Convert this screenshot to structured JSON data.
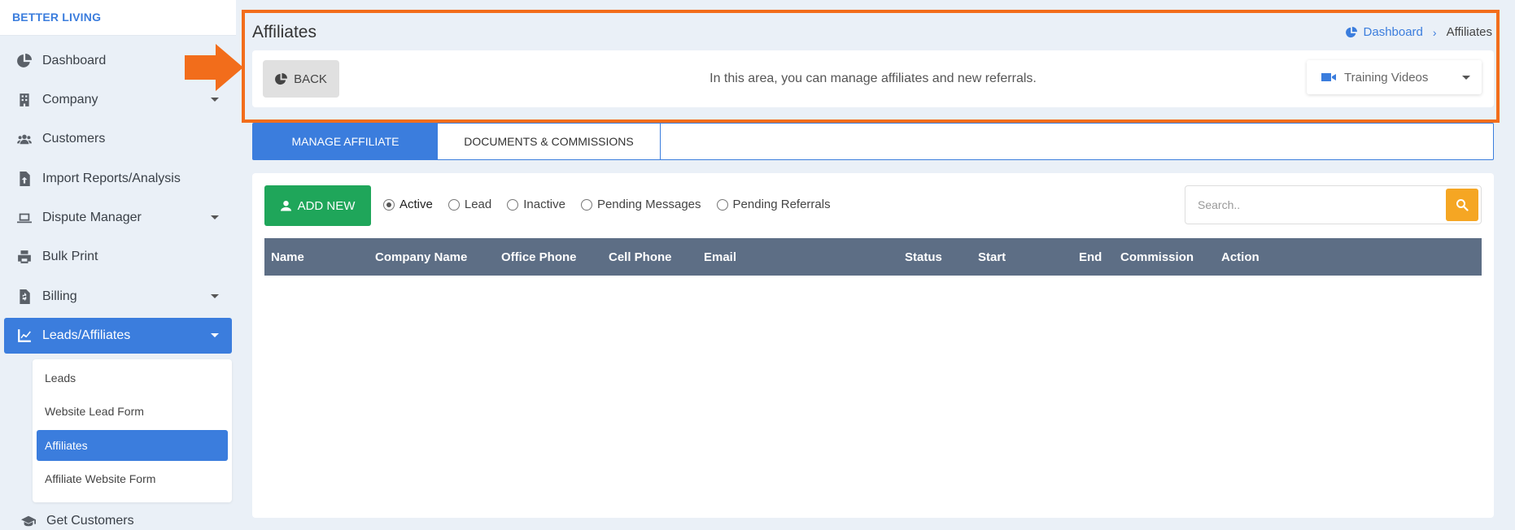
{
  "brand": "BETTER LIVING",
  "sidebar": {
    "items": [
      {
        "label": "Dashboard"
      },
      {
        "label": "Company"
      },
      {
        "label": "Customers"
      },
      {
        "label": "Import Reports/Analysis"
      },
      {
        "label": "Dispute Manager"
      },
      {
        "label": "Bulk Print"
      },
      {
        "label": "Billing"
      },
      {
        "label": "Leads/Affiliates"
      },
      {
        "label": "Get Customers"
      }
    ],
    "submenu": [
      {
        "label": "Leads"
      },
      {
        "label": "Website Lead Form"
      },
      {
        "label": "Affiliates"
      },
      {
        "label": "Affiliate Website Form"
      }
    ]
  },
  "header": {
    "title": "Affiliates",
    "breadcrumb": {
      "home": "Dashboard",
      "current": "Affiliates"
    }
  },
  "info_bar": {
    "back_label": "BACK",
    "text": "In this area, you can manage affiliates and new referrals.",
    "training_label": "Training Videos"
  },
  "tabs": [
    {
      "label": "MANAGE AFFILIATE"
    },
    {
      "label": "DOCUMENTS & COMMISSIONS"
    }
  ],
  "toolbar": {
    "add_label": "ADD NEW",
    "filters": [
      {
        "label": "Active",
        "checked": true
      },
      {
        "label": "Lead"
      },
      {
        "label": "Inactive"
      },
      {
        "label": "Pending Messages"
      },
      {
        "label": "Pending Referrals"
      }
    ],
    "search_placeholder": "Search.."
  },
  "table": {
    "columns": [
      "Name",
      "Company Name",
      "Office Phone",
      "Cell Phone",
      "Email",
      "Status",
      "Start",
      "End",
      "Commission",
      "Action"
    ],
    "rows": []
  },
  "colors": {
    "accent": "#3b7ddd",
    "highlight": "#f26d1b",
    "add_button": "#1fa65a",
    "search_button": "#f5a623",
    "table_header": "#5d6e85"
  }
}
